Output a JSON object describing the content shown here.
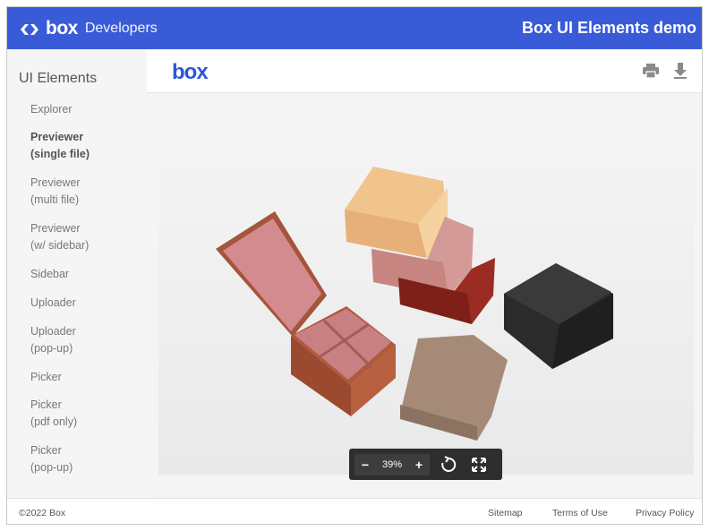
{
  "header": {
    "brand_box": "box",
    "brand_developers": "Developers",
    "title": "Box UI Elements demo"
  },
  "sidebar": {
    "heading": "UI Elements",
    "items": [
      {
        "line1": "Explorer",
        "line2": ""
      },
      {
        "line1": "Previewer",
        "line2": "(single file)",
        "active": true
      },
      {
        "line1": "Previewer",
        "line2": "(multi file)"
      },
      {
        "line1": "Previewer",
        "line2": "(w/ sidebar)"
      },
      {
        "line1": "Sidebar",
        "line2": ""
      },
      {
        "line1": "Uploader",
        "line2": ""
      },
      {
        "line1": "Uploader",
        "line2": "(pop-up)"
      },
      {
        "line1": "Picker",
        "line2": ""
      },
      {
        "line1": "Picker",
        "line2": "(pdf only)"
      },
      {
        "line1": "Picker",
        "line2": "(pop-up)"
      }
    ]
  },
  "preview": {
    "logo": "box",
    "toolbar_icons": [
      "print-icon",
      "download-icon"
    ],
    "image_description_icon": "photo-jewelry-boxes",
    "zoom": {
      "minus": "−",
      "level": "39%",
      "plus": "+"
    },
    "controls_icons": [
      "rotate-icon",
      "fullscreen-icon"
    ]
  },
  "footer": {
    "copyright": "©2022 Box",
    "links": [
      "Sitemap",
      "Terms of Use",
      "Privacy Policy"
    ]
  },
  "colors": {
    "header_bg": "#3a5bd8",
    "box_blue": "#2b57d6",
    "zoombar_bg": "#2e2e2e"
  }
}
